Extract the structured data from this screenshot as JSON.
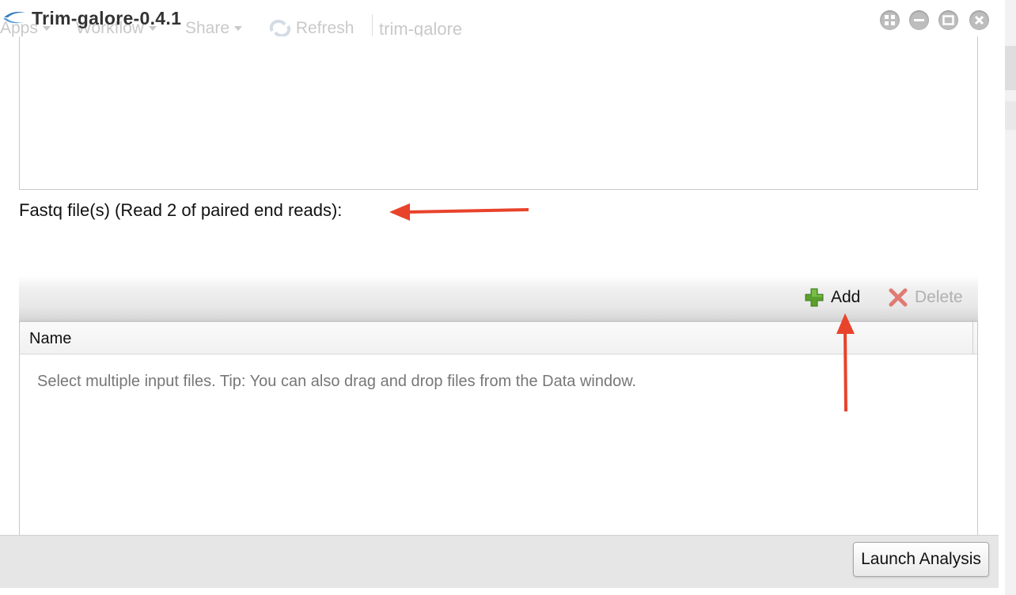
{
  "window": {
    "title": "Trim-galore-0.4.1"
  },
  "background_toolbar": {
    "apps": "Apps",
    "workflow": "Workflow",
    "share": "Share",
    "refresh": "Refresh",
    "search_value": "trim-galore"
  },
  "form": {
    "field_label": "Fastq file(s) (Read 2 of paired end reads):",
    "toolbar": {
      "add_label": "Add",
      "delete_label": "Delete"
    },
    "grid": {
      "column_name": "Name",
      "empty_text": "Select multiple input files. Tip: You can also drag and drop files from the Data window."
    }
  },
  "footer": {
    "launch_label": "Launch Analysis"
  },
  "colors": {
    "annotation_arrow": "#e8432b",
    "add_icon": "#5aa02c",
    "delete_icon": "#e07b73"
  },
  "icons": [
    "app-logo-icon",
    "window-grid-icon",
    "window-minimize-icon",
    "window-maximize-icon",
    "window-close-icon",
    "add-icon",
    "delete-icon",
    "refresh-icon"
  ]
}
